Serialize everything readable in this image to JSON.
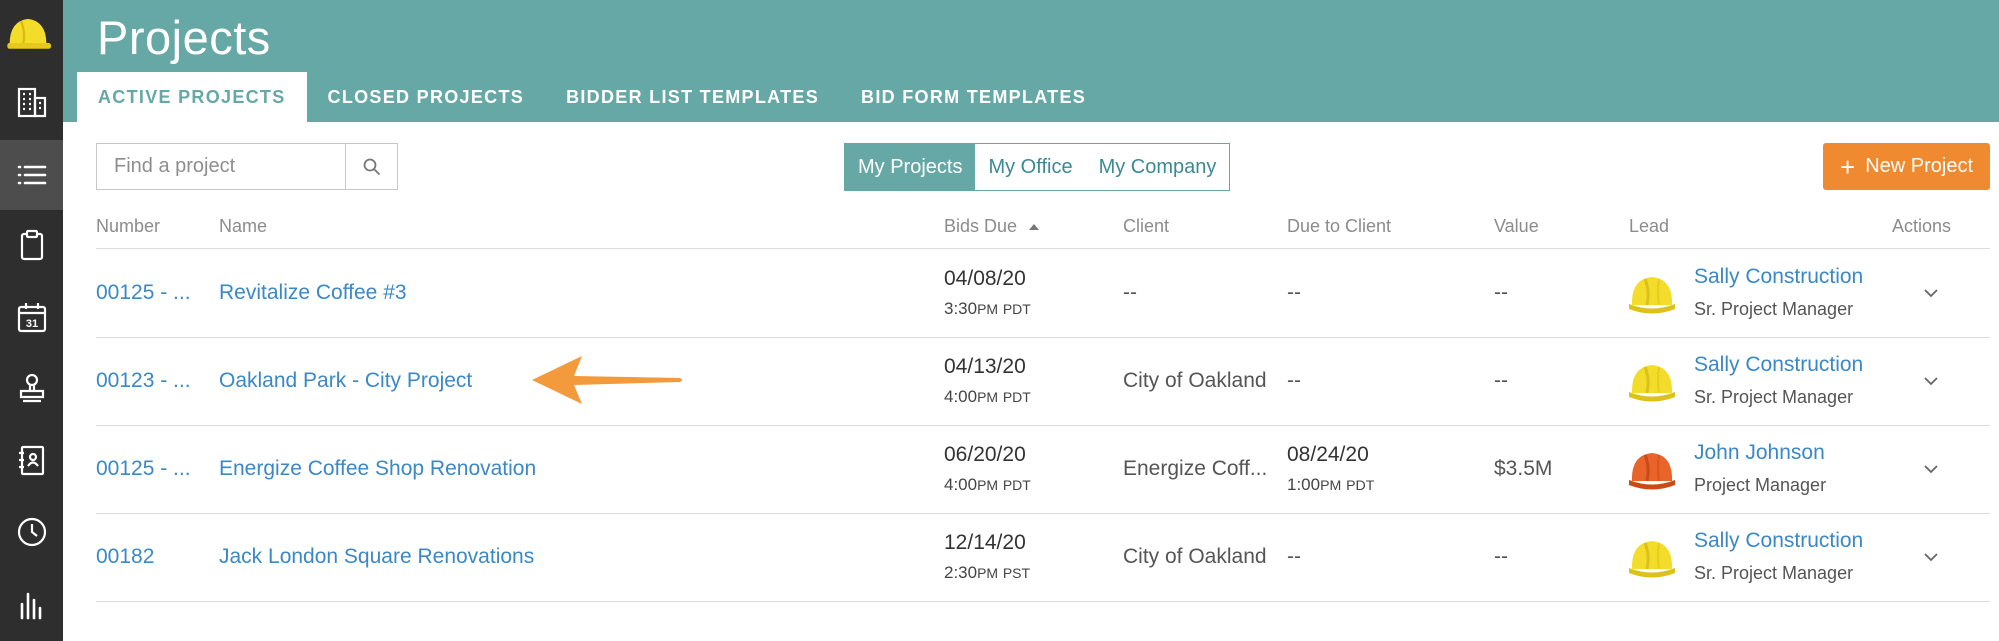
{
  "header": {
    "title": "Projects",
    "tabs": [
      {
        "label": "ACTIVE PROJECTS",
        "active": true
      },
      {
        "label": "CLOSED PROJECTS",
        "active": false
      },
      {
        "label": "BIDDER LIST TEMPLATES",
        "active": false
      },
      {
        "label": "BID FORM TEMPLATES",
        "active": false
      }
    ]
  },
  "sidebar": {
    "items": [
      {
        "icon": "hard-hat-logo-icon"
      },
      {
        "icon": "building-icon"
      },
      {
        "icon": "list-icon",
        "active": true
      },
      {
        "icon": "clipboard-icon"
      },
      {
        "icon": "calendar-icon",
        "text": "31"
      },
      {
        "icon": "stamp-icon"
      },
      {
        "icon": "contact-book-icon"
      },
      {
        "icon": "clock-icon"
      },
      {
        "icon": "bar-chart-icon"
      }
    ]
  },
  "toolbar": {
    "search_placeholder": "Find a project",
    "scope": [
      "My Projects",
      "My Office",
      "My Company"
    ],
    "scope_active": "My Projects",
    "new_button": "New Project"
  },
  "table": {
    "columns": [
      "Number",
      "Name",
      "Bids Due",
      "Client",
      "Due to Client",
      "Value",
      "Lead",
      "Actions"
    ],
    "sort_column": "Bids Due",
    "sort_direction": "ascending",
    "rows": [
      {
        "number": "00125 - ...",
        "name": "Revitalize Coffee #3",
        "bids_due_date": "04/08/20",
        "bids_due_time": "3:30",
        "bids_due_ampm": "PM",
        "bids_due_tz": "PDT",
        "client": "--",
        "due_to_client": "--",
        "due_to_client_time": "",
        "due_to_client_ampm": "",
        "due_to_client_tz": "",
        "value": "--",
        "lead_name": "Sally Construction",
        "lead_role": "Sr. Project Manager",
        "lead_avatar_color": "#f3dd2a"
      },
      {
        "number": "00123 - ...",
        "name": "Oakland Park - City Project",
        "bids_due_date": "04/13/20",
        "bids_due_time": "4:00",
        "bids_due_ampm": "PM",
        "bids_due_tz": "PDT",
        "client": "City of Oakland",
        "due_to_client": "--",
        "due_to_client_time": "",
        "due_to_client_ampm": "",
        "due_to_client_tz": "",
        "value": "--",
        "lead_name": "Sally Construction",
        "lead_role": "Sr. Project Manager",
        "lead_avatar_color": "#f3dd2a"
      },
      {
        "number": "00125 - ...",
        "name": "Energize Coffee Shop Renovation",
        "bids_due_date": "06/20/20",
        "bids_due_time": "4:00",
        "bids_due_ampm": "PM",
        "bids_due_tz": "PDT",
        "client": "Energize Coff...",
        "due_to_client": "08/24/20",
        "due_to_client_time": "1:00",
        "due_to_client_ampm": "PM",
        "due_to_client_tz": "PDT",
        "value": "$3.5M",
        "lead_name": "John Johnson",
        "lead_role": "Project Manager",
        "lead_avatar_color": "#e8642a"
      },
      {
        "number": "00182",
        "name": "Jack London Square Renovations",
        "bids_due_date": "12/14/20",
        "bids_due_time": "2:30",
        "bids_due_ampm": "PM",
        "bids_due_tz": "PST",
        "client": "City of Oakland",
        "due_to_client": "--",
        "due_to_client_time": "",
        "due_to_client_ampm": "",
        "due_to_client_tz": "",
        "value": "--",
        "lead_name": "Sally Construction",
        "lead_role": "Sr. Project Manager",
        "lead_avatar_color": "#f3dd2a"
      }
    ]
  },
  "colors": {
    "header": "#66a8a5",
    "sidebar": "#2e2e2e",
    "link": "#3a88c8",
    "new_button": "#ef8a30",
    "annotation_arrow": "#f29a3c"
  }
}
